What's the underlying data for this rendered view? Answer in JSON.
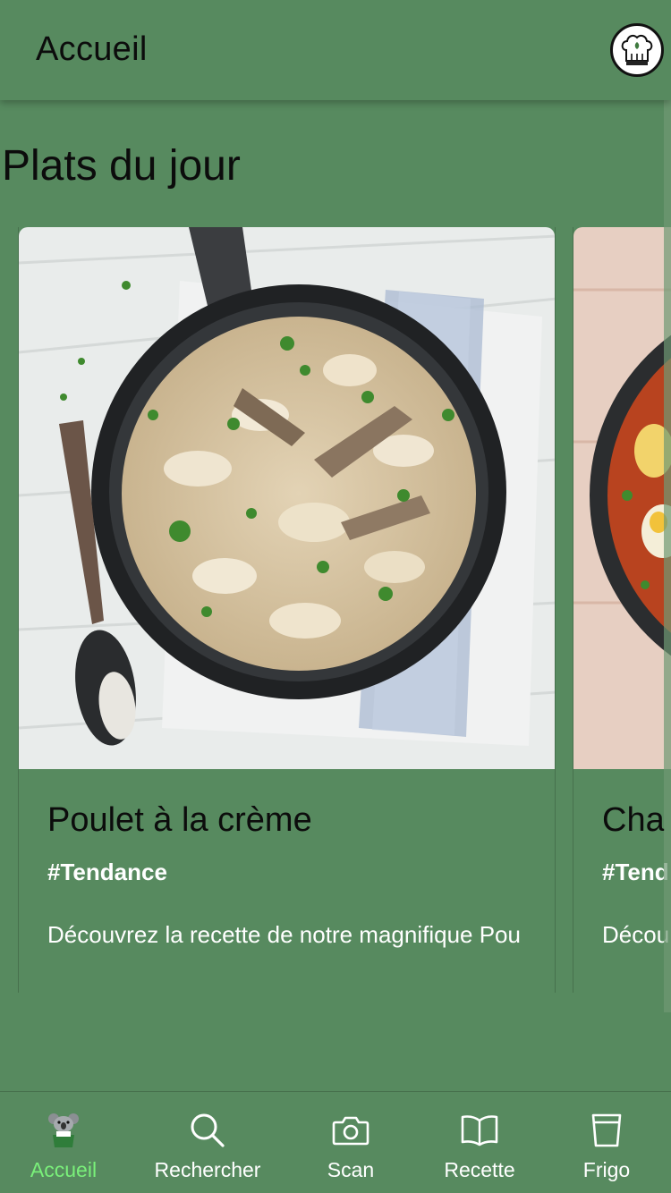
{
  "header": {
    "title": "Accueil",
    "profile_icon": "chef-hat-icon"
  },
  "section": {
    "title": "Plats du jour"
  },
  "cards": [
    {
      "title": "Poulet à la crème",
      "tag": "#Tendance",
      "description": "Découvrez la recette de notre magnifique Pou"
    },
    {
      "title": "Cha",
      "tag": "#Tend",
      "description": "Décou"
    }
  ],
  "tabs": [
    {
      "label": "Accueil",
      "icon": "chef-koala-icon",
      "active": true
    },
    {
      "label": "Rechercher",
      "icon": "search-icon",
      "active": false
    },
    {
      "label": "Scan",
      "icon": "camera-icon",
      "active": false
    },
    {
      "label": "Recette",
      "icon": "book-icon",
      "active": false
    },
    {
      "label": "Frigo",
      "icon": "cup-icon",
      "active": false
    }
  ],
  "colors": {
    "background": "#578a5f",
    "active_tab": "#7af07a"
  }
}
